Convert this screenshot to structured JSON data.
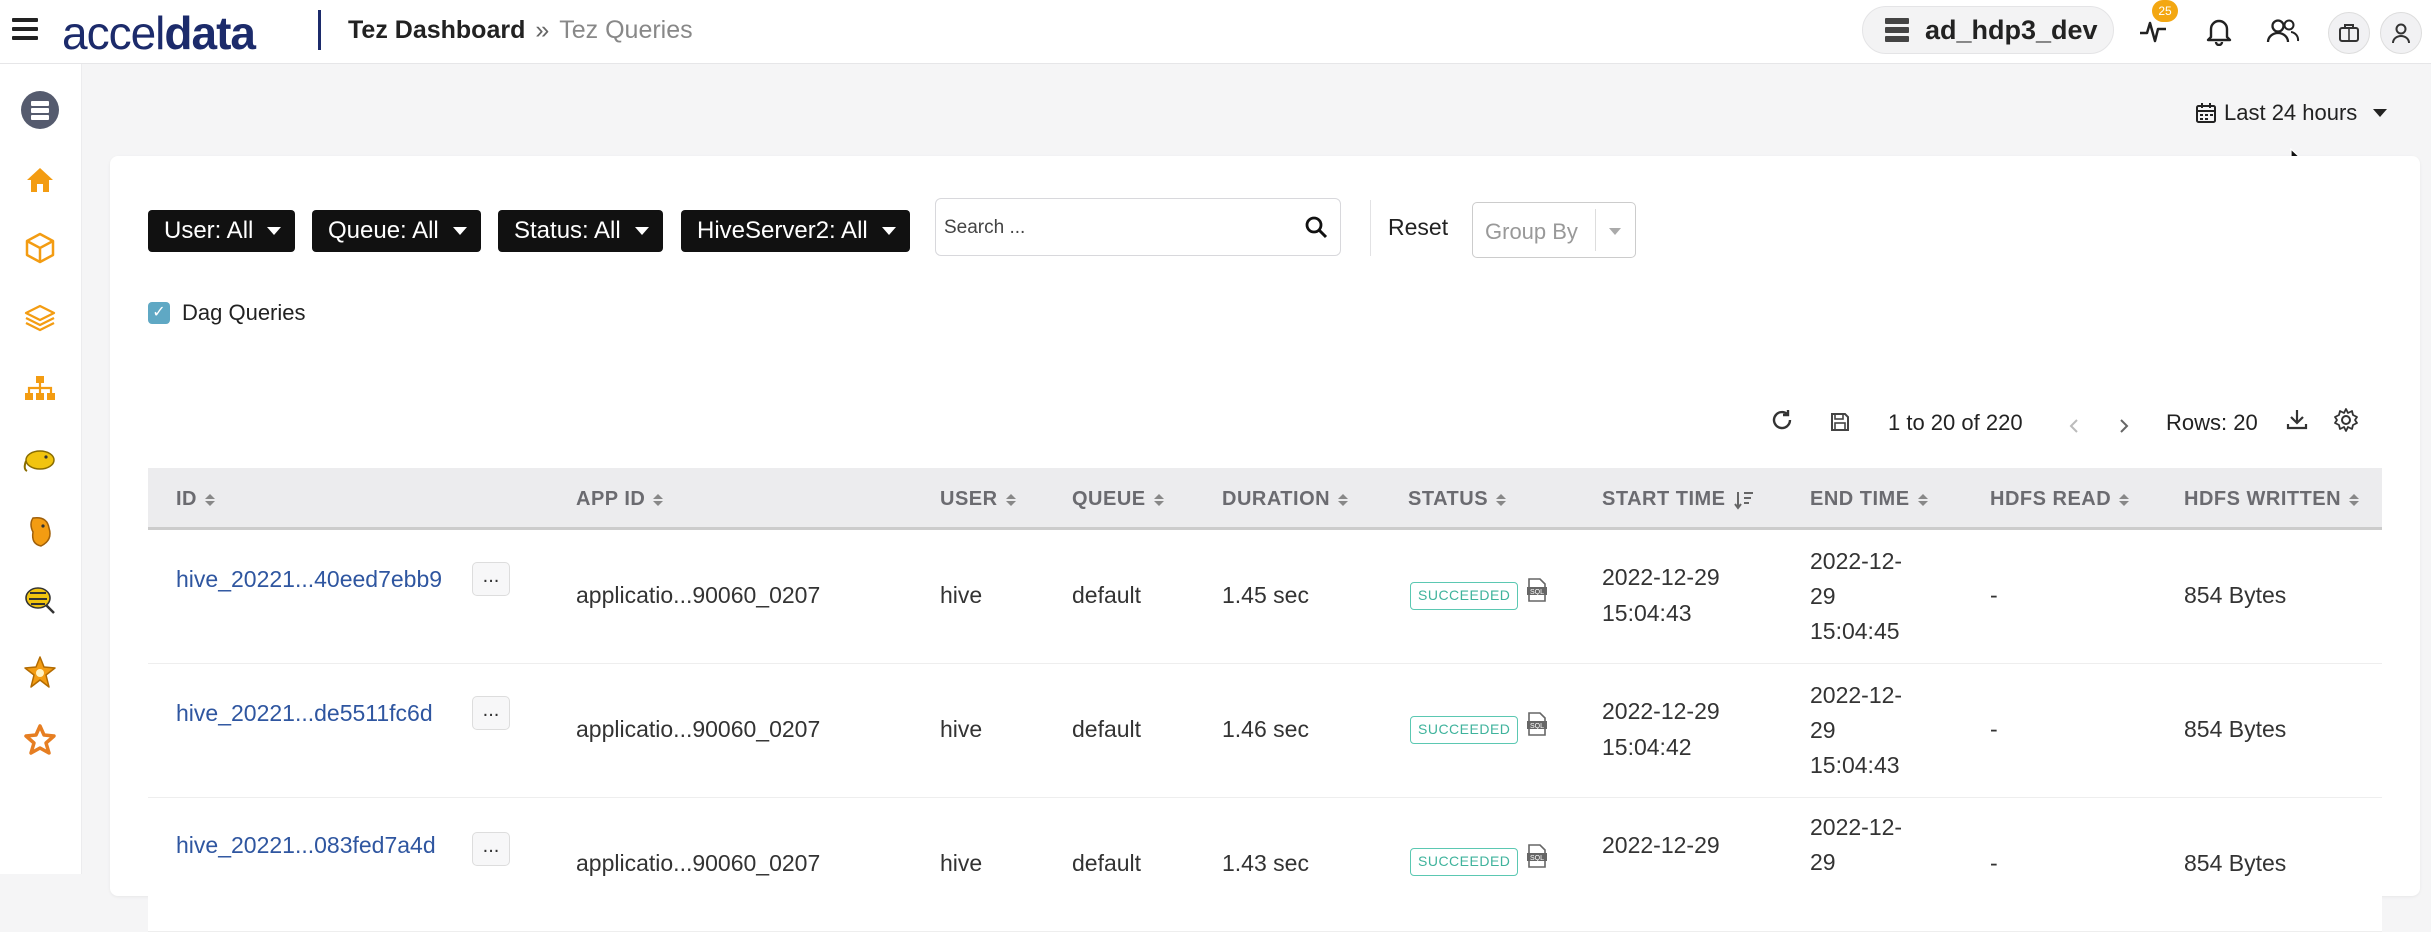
{
  "header": {
    "logo_part1": "accel",
    "logo_part2": "data",
    "breadcrumb_current_section": "Tez Dashboard",
    "breadcrumb_separator": "»",
    "breadcrumb_page": "Tez Queries",
    "cluster_name": "ad_hdp3_dev",
    "alerts_badge": "25"
  },
  "sidebar": {
    "items": [
      "database-icon",
      "home-icon",
      "cube-icon",
      "layers-icon",
      "hierarchy-icon",
      "hadoop-elephant-icon",
      "hive-icon",
      "hive-bee-icon",
      "spark-star-icon",
      "kafka-star-icon"
    ]
  },
  "date_range": {
    "label": "Last 24 hours"
  },
  "filters": {
    "user": "User: All",
    "queue": "Queue: All",
    "status": "Status: All",
    "hiveserver2": "HiveServer2: All",
    "search_placeholder": "Search ...",
    "reset_label": "Reset",
    "group_by_placeholder": "Group By",
    "dag_queries_label": "Dag Queries",
    "dag_queries_checked": true
  },
  "pagination": {
    "range_text": "1 to 20 of 220",
    "rows_label": "Rows: 20"
  },
  "table": {
    "columns": [
      "ID",
      "APP ID",
      "USER",
      "QUEUE",
      "DURATION",
      "STATUS",
      "START TIME",
      "END TIME",
      "HDFS READ",
      "HDFS WRITTEN"
    ],
    "more_label": "...",
    "rows": [
      {
        "id": "hive_20221...40eed7ebb9",
        "app_id": "applicatio...90060_0207",
        "user": "hive",
        "queue": "default",
        "duration": "1.45 sec",
        "status": "SUCCEEDED",
        "start_date": "2022-12-29",
        "start_time": "15:04:43",
        "end_l1": "2022-12-",
        "end_l2": "29",
        "end_l3": "15:04:45",
        "hdfs_read": "-",
        "hdfs_written": "854 Bytes"
      },
      {
        "id": "hive_20221...de5511fc6d",
        "app_id": "applicatio...90060_0207",
        "user": "hive",
        "queue": "default",
        "duration": "1.46 sec",
        "status": "SUCCEEDED",
        "start_date": "2022-12-29",
        "start_time": "15:04:42",
        "end_l1": "2022-12-",
        "end_l2": "29",
        "end_l3": "15:04:43",
        "hdfs_read": "-",
        "hdfs_written": "854 Bytes"
      },
      {
        "id": "hive_20221...083fed7a4d",
        "app_id": "applicatio...90060_0207",
        "user": "hive",
        "queue": "default",
        "duration": "1.43 sec",
        "status": "SUCCEEDED",
        "start_date": "2022-12-29",
        "start_time": "",
        "end_l1": "2022-12-",
        "end_l2": "29",
        "end_l3": "",
        "hdfs_read": "-",
        "hdfs_written": "854 Bytes"
      }
    ]
  },
  "colors": {
    "brand": "#1c2b6b",
    "sidebar_icon": "#f39c12",
    "link": "#2f56a0",
    "status_success": "#3fb39c",
    "checkbox": "#5fa8c4"
  }
}
